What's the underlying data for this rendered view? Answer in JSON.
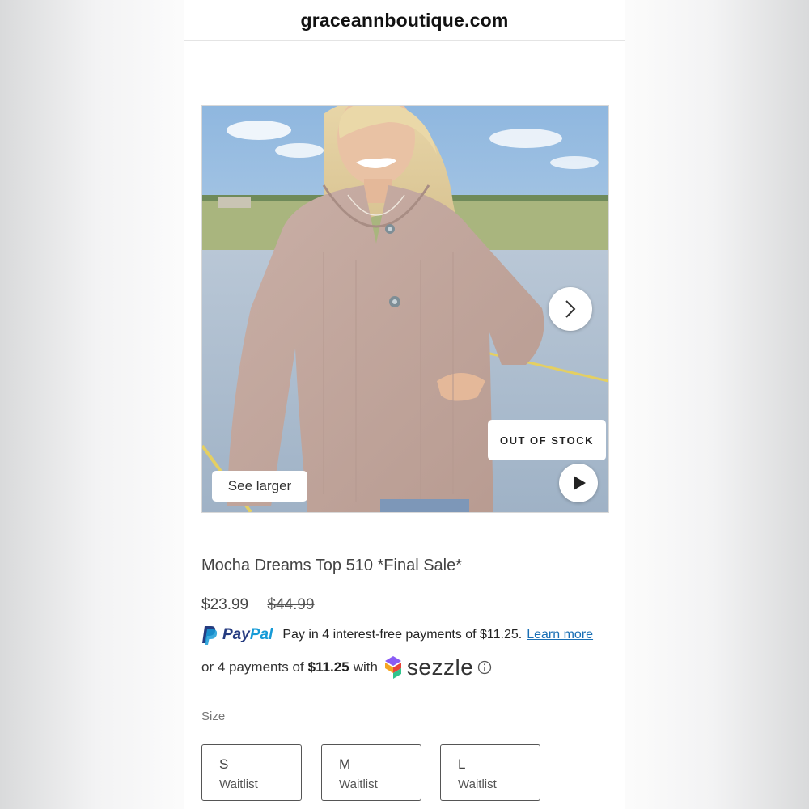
{
  "browser": {
    "domain": "graceannboutique.com"
  },
  "gallery": {
    "photo_description": "model-in-mocha-henley-top",
    "stock_badge": "OUT OF STOCK",
    "see_larger_label": "See larger"
  },
  "product": {
    "title": "Mocha Dreams Top 510 *Final Sale*",
    "price": "$23.99",
    "compare_price": "$44.99"
  },
  "paypal": {
    "word_pay": "Pay",
    "word_pal": "Pal",
    "message": "Pay in 4 interest-free payments of $11.25.",
    "learn_more": "Learn more"
  },
  "sezzle": {
    "prefix": "or 4 payments of",
    "amount": "$11.25",
    "suffix": "with",
    "brand": "sezzle"
  },
  "size": {
    "label": "Size",
    "options": [
      {
        "size": "S",
        "status": "Waitlist"
      },
      {
        "size": "M",
        "status": "Waitlist"
      },
      {
        "size": "L",
        "status": "Waitlist"
      }
    ]
  },
  "colors": {
    "paypal_dark": "#253b80",
    "paypal_light": "#179bd7",
    "link": "#1a6fb5",
    "top_fabric": "#c4a9a0"
  }
}
